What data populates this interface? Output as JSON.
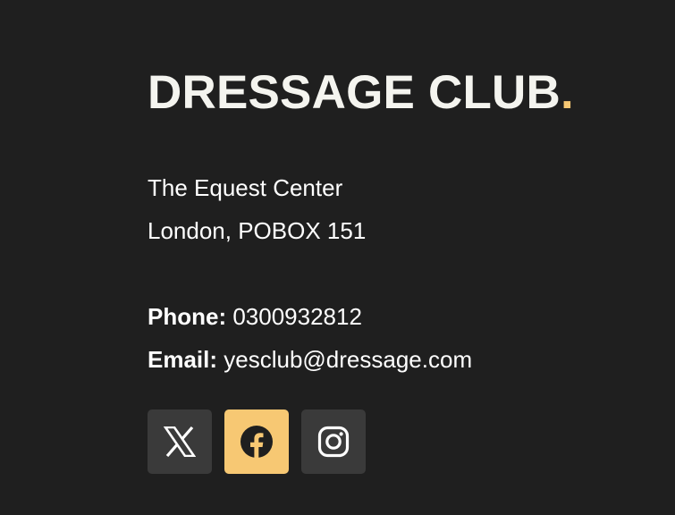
{
  "brand": {
    "name": "DRESSAGE CLUB",
    "dot": ".",
    "accent_color": "#f7c873"
  },
  "address": {
    "line1": "The Equest Center",
    "line2": "London, POBOX 151"
  },
  "contact": {
    "phone_label": "Phone:",
    "phone_value": " 0300932812",
    "email_label": "Email:",
    "email_value": " yesclub@dressage.com"
  },
  "socials": [
    {
      "icon": "x-twitter-icon",
      "active": false
    },
    {
      "icon": "facebook-icon",
      "active": true
    },
    {
      "icon": "instagram-icon",
      "active": false
    }
  ],
  "colors": {
    "background": "#1f1f1f",
    "button_bg": "#3a3a3a",
    "button_active_bg": "#f7c873"
  }
}
